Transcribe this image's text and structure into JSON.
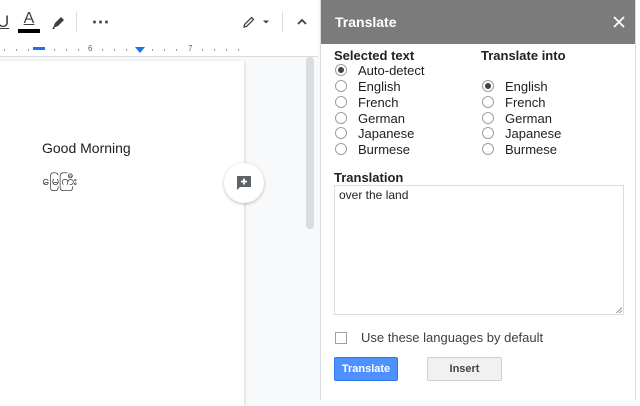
{
  "toolbar": {
    "underline_glyph": "U",
    "text_color_glyph": "A",
    "more_glyph": "⋯",
    "icons": [
      "underline-icon",
      "text-color-icon",
      "highlight-pen-icon",
      "more-icon",
      "pencil-icon",
      "chevron-down-icon",
      "chevron-up-icon"
    ]
  },
  "ruler": {
    "mark_6": "6",
    "mark_7": "7"
  },
  "document": {
    "lines": [
      "Good Morning",
      "မြေကြီး"
    ]
  },
  "panel": {
    "title": "Translate",
    "source": {
      "heading": "Selected text",
      "options": [
        "Auto-detect",
        "English",
        "French",
        "German",
        "Japanese",
        "Burmese"
      ],
      "selected": "Auto-detect"
    },
    "target": {
      "heading": "Translate into",
      "options": [
        "English",
        "French",
        "German",
        "Japanese",
        "Burmese"
      ],
      "selected": "English"
    },
    "translation_label": "Translation",
    "translation_text": "over the land",
    "default_checkbox_label": "Use these languages by default",
    "default_checked": false,
    "translate_button": "Translate",
    "insert_button": "Insert"
  },
  "colors": {
    "header_bg": "#7b7b7b",
    "primary_button": "#4d90fe",
    "accent_blue": "#1a73e8"
  }
}
